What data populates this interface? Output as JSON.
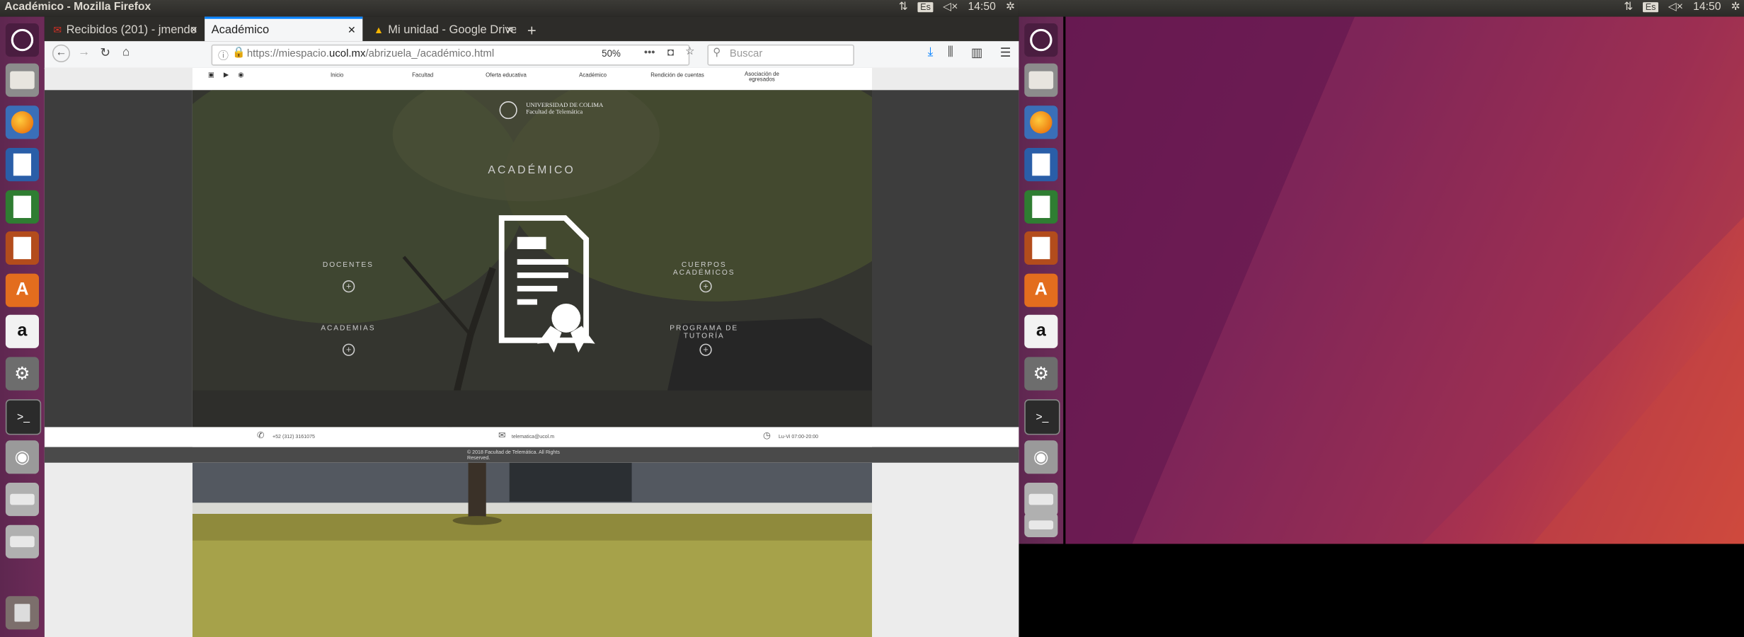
{
  "window_title": "Académico - Mozilla Firefox",
  "tray": {
    "keyboard": "Es",
    "time": "14:50"
  },
  "tabs": [
    {
      "label": "Recibidos (201) - jmendo",
      "icon": "gmail-icon"
    },
    {
      "label": "Académico",
      "icon": ""
    },
    {
      "label": "Mi unidad - Google Drive",
      "icon": "drive-icon"
    }
  ],
  "url": {
    "prefix": "https://miespacio.",
    "domain": "ucol.mx",
    "path": "/abrizuela_/académico.html"
  },
  "zoom": "50%",
  "search_placeholder": "Buscar",
  "site": {
    "nav": [
      "Inicio",
      "Facultad",
      "Oferta educativa",
      "Académico",
      "Rendición de cuentas",
      "Asociación de egresados"
    ],
    "logo_line1": "UNIVERSIDAD DE COLIMA",
    "logo_line2": "Facultad de Telemática",
    "heading": "ACADÉMICO",
    "items": [
      "DOCENTES",
      "CUERPOS ACADÉMICOS",
      "ACADEMIAS",
      "PROGRAMA DE TUTORÍA"
    ],
    "phone": "+52 (312) 3161075",
    "email": "telematica@ucol.m",
    "hours": "Lu-Vi 07:00-20:00",
    "copyright": "© 2018 Facultad de Telemática. All Rights Reserved."
  },
  "launcher_icons": [
    "ubuntu-dash-icon",
    "files-icon",
    "firefox-icon",
    "writer-icon",
    "calc-icon",
    "impress-icon",
    "software-center-icon",
    "amazon-icon",
    "settings-icon",
    "terminal-icon",
    "camera-icon",
    "drive-icon",
    "drive-icon",
    "trash-icon"
  ],
  "colors": {
    "launcher": "#5e2750",
    "accent": "#0a84ff",
    "topbar": "#3c3b37"
  }
}
